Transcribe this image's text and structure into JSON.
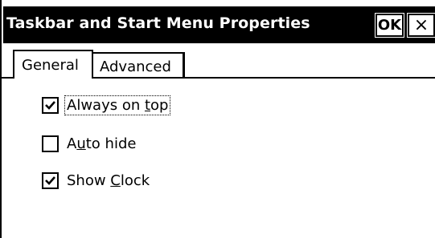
{
  "window": {
    "title": "Taskbar and Start Menu Properties",
    "ok_label": "OK",
    "close_label": "×"
  },
  "tabs": [
    {
      "label": "General",
      "selected": true
    },
    {
      "label": "Advanced",
      "selected": false
    }
  ],
  "options": [
    {
      "label_pre": "Always on ",
      "label_ul": "t",
      "label_post": "op",
      "checked": true,
      "focused": true
    },
    {
      "label_pre": "A",
      "label_ul": "u",
      "label_post": "to hide",
      "checked": false,
      "focused": false
    },
    {
      "label_pre": "Show ",
      "label_ul": "C",
      "label_post": "lock",
      "checked": true,
      "focused": false
    }
  ]
}
